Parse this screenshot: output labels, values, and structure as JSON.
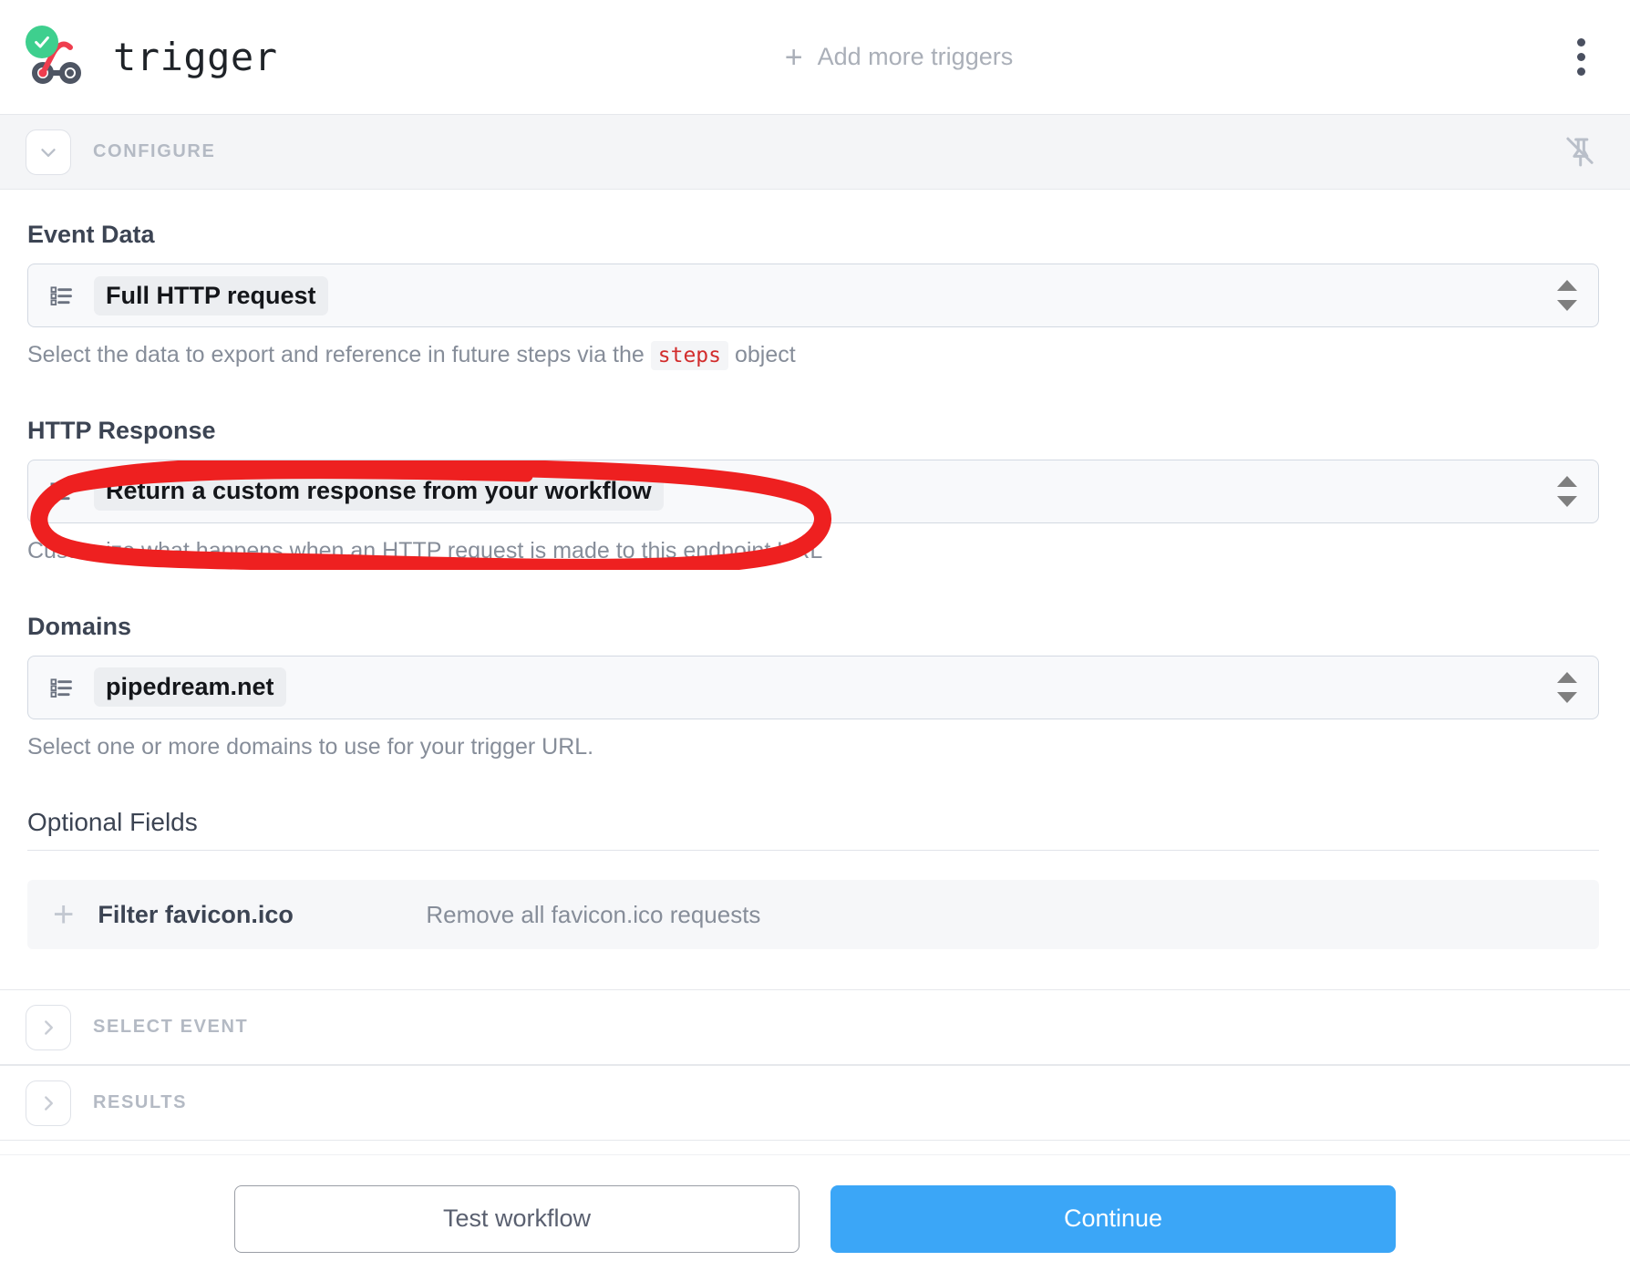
{
  "header": {
    "trigger_name": "trigger",
    "status_icon": "green-check-badge-icon",
    "trigger_type_icon": "webhook-icon",
    "add_triggers_label": "Add more triggers",
    "add_icon": "plus-icon",
    "menu_icon": "kebab-menu-icon"
  },
  "sections": [
    {
      "id": "configure",
      "title": "CONFIGURE",
      "expanded": true,
      "chevron": "chevron-down-icon",
      "pin_icon": "pin-off-icon"
    },
    {
      "id": "select-event",
      "title": "SELECT EVENT",
      "expanded": false,
      "chevron": "chevron-right-icon"
    },
    {
      "id": "results",
      "title": "RESULTS",
      "expanded": false,
      "chevron": "chevron-right-icon"
    }
  ],
  "fields": [
    {
      "label": "Event Data",
      "value": "Full HTTP request",
      "icon": "list-options-icon",
      "control": "select",
      "helper_before": "Select the data to export and reference in future steps via the",
      "helper_code": "steps",
      "helper_after": "object"
    },
    {
      "label": "HTTP Response",
      "value": "Return a custom response from your workflow",
      "icon": "list-options-icon",
      "control": "select",
      "helper": "Customize what happens when an HTTP request is made to this endpoint URL",
      "annotated": true
    },
    {
      "label": "Domains",
      "value": "pipedream.net",
      "icon": "list-options-icon",
      "control": "select",
      "helper": "Select one or more domains to use for your trigger URL."
    }
  ],
  "optional_fields": {
    "heading": "Optional Fields",
    "rows": [
      {
        "add_icon": "plus-icon",
        "name": "Filter favicon.ico",
        "description": "Remove all favicon.ico requests"
      }
    ]
  },
  "footer": {
    "test_label": "Test workflow",
    "continue_label": "Continue"
  },
  "annotation": {
    "type": "hand-drawn-ellipse",
    "color": "#ee2020",
    "target": "HTTP Response"
  },
  "colors": {
    "accent_primary": "#3ba6f7",
    "status_green": "#3ecf8e",
    "annotation_red": "#ee2020",
    "code_red": "#d22d2d",
    "section_bg": "#f4f5f7",
    "field_bg": "#f8f9fb",
    "text_dark": "#3c4453",
    "text_muted": "#868d99",
    "text_section": "#b4bac4"
  }
}
